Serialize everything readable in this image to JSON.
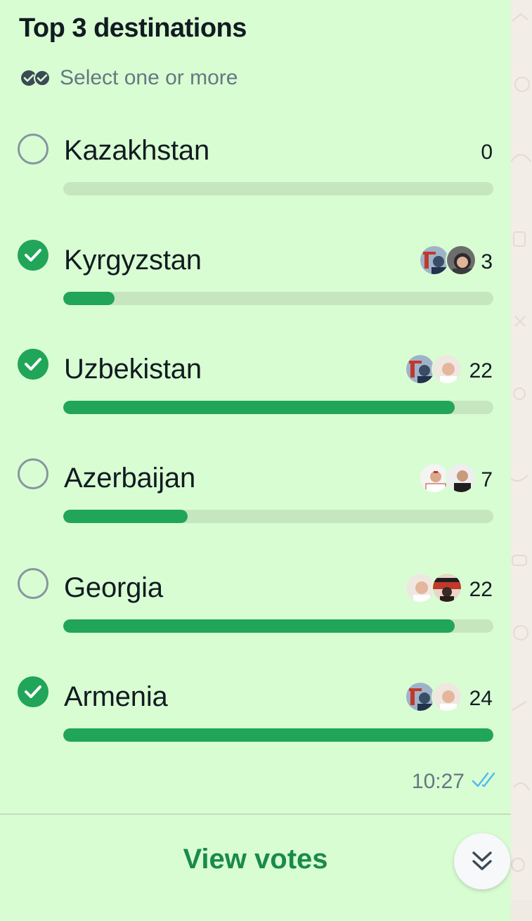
{
  "poll": {
    "title": "Top 3 destinations",
    "subtitle": "Select one or more",
    "options": [
      {
        "label": "Kazakhstan",
        "votes": "0",
        "selected": false,
        "fill": 0.0
      },
      {
        "label": "Kyrgyzstan",
        "votes": "3",
        "selected": true,
        "fill": 0.12
      },
      {
        "label": "Uzbekistan",
        "votes": "22",
        "selected": true,
        "fill": 0.91
      },
      {
        "label": "Azerbaijan",
        "votes": "7",
        "selected": false,
        "fill": 0.29
      },
      {
        "label": "Georgia",
        "votes": "22",
        "selected": false,
        "fill": 0.91
      },
      {
        "label": "Armenia",
        "votes": "24",
        "selected": true,
        "fill": 1.0
      }
    ],
    "time": "10:27",
    "view_votes": "View votes"
  },
  "colors": {
    "bubble": "#d9fdd3",
    "accent": "#21a558",
    "track": "#c6e6c0",
    "read_ticks": "#53bdeb"
  },
  "icons": {
    "multi_select": "double-check-circle-icon",
    "read_receipt": "double-tick-icon",
    "scroll": "double-chevron-down-icon"
  }
}
